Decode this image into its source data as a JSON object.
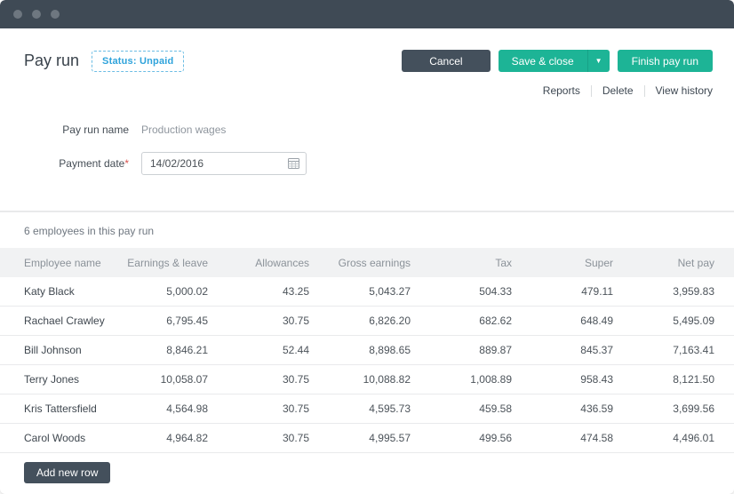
{
  "window": {
    "titlebar_dots": 3
  },
  "header": {
    "title": "Pay run",
    "status_badge": "Status: Unpaid",
    "buttons": {
      "cancel": "Cancel",
      "save_close": "Save & close",
      "save_close_caret": "▼",
      "finish": "Finish pay run"
    },
    "links": [
      {
        "label": "Reports"
      },
      {
        "label": "Delete"
      },
      {
        "label": "View history"
      }
    ]
  },
  "form": {
    "pay_run_name": {
      "label": "Pay run name",
      "value": "Production wages"
    },
    "payment_date": {
      "label": "Payment date",
      "required_mark": "*",
      "value": "14/02/2016"
    }
  },
  "summary": "6 employees in this pay run",
  "table": {
    "columns": [
      "Employee name",
      "Earnings & leave",
      "Allowances",
      "Gross earnings",
      "Tax",
      "Super",
      "Net pay"
    ],
    "rows": [
      [
        "Katy Black",
        "5,000.02",
        "43.25",
        "5,043.27",
        "504.33",
        "479.11",
        "3,959.83"
      ],
      [
        "Rachael Crawley",
        "6,795.45",
        "30.75",
        "6,826.20",
        "682.62",
        "648.49",
        "5,495.09"
      ],
      [
        "Bill Johnson",
        "8,846.21",
        "52.44",
        "8,898.65",
        "889.87",
        "845.37",
        "7,163.41"
      ],
      [
        "Terry Jones",
        "10,058.07",
        "30.75",
        "10,088.82",
        "1,008.89",
        "958.43",
        "8,121.50"
      ],
      [
        "Kris Tattersfield",
        "4,564.98",
        "30.75",
        "4,595.73",
        "459.58",
        "436.59",
        "3,699.56"
      ],
      [
        "Carol Woods",
        "4,964.82",
        "30.75",
        "4,995.57",
        "499.56",
        "474.58",
        "4,496.01"
      ]
    ]
  },
  "footer": {
    "add_row": "Add new row"
  },
  "colors": {
    "accent_green": "#1db496",
    "slate_button": "#44505c",
    "status_blue": "#2fa3db",
    "titlebar": "#3f4a55",
    "table_header_bg": "#f1f2f3",
    "row_border": "#e9eaec",
    "required_red": "#d9534f"
  }
}
